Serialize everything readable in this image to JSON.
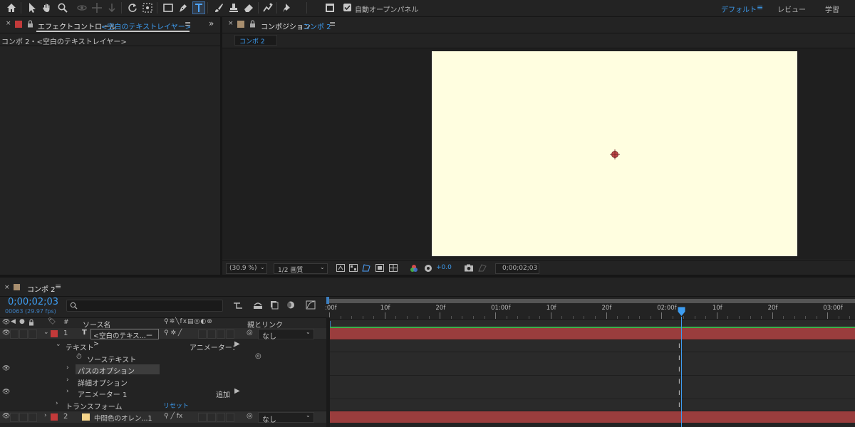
{
  "toolbar": {
    "auto_open_label": "自動オープンパネル",
    "workspaces": [
      "デフォルト",
      "レビュー",
      "学習"
    ]
  },
  "effect_panel": {
    "tab_label": "エフェクトコントロール",
    "tab_target": "<空白のテキストレイヤー>",
    "breadcrumb": "コンポ 2・<空白のテキストレイヤー>"
  },
  "comp_panel": {
    "tab_label": "コンポジション",
    "tab_comp": "コンポ 2",
    "sub_tab": "コンポ 2",
    "zoom": "(30.9 %)",
    "resolution": "1/2 画質",
    "exposure": "+0.0",
    "timecode": "0;00;02;03",
    "canvas_color": "#fffee0"
  },
  "timeline": {
    "tab_label": "コンポ 2",
    "current_time": "0;00;02;03",
    "frame_info": "00063 (29.97 fps)",
    "search_placeholder": "",
    "headers": {
      "num": "#",
      "source": "ソース名",
      "parent": "親とリンク"
    },
    "ruler_labels": [
      ":00f",
      "10f",
      "20f",
      "01:00f",
      "10f",
      "20f",
      "02:00f",
      "10f",
      "20f",
      "03:00f"
    ],
    "rows": [
      {
        "num": "1",
        "name": "<空白のテキス...ー>",
        "parent": "なし",
        "label_color": "#c23a3a"
      },
      {
        "name": "テキスト",
        "right": "アニメーター："
      },
      {
        "name": "ソーステキスト"
      },
      {
        "name": "パスのオプション"
      },
      {
        "name": "詳細オプション"
      },
      {
        "name": "アニメーター 1",
        "right": "追加"
      },
      {
        "name": "トランスフォーム",
        "right": "リセット"
      },
      {
        "num": "2",
        "name": "中間色のオレン...1",
        "parent": "なし",
        "label_color": "#c23a3a",
        "swatch_color": "#f6d58a"
      }
    ]
  }
}
